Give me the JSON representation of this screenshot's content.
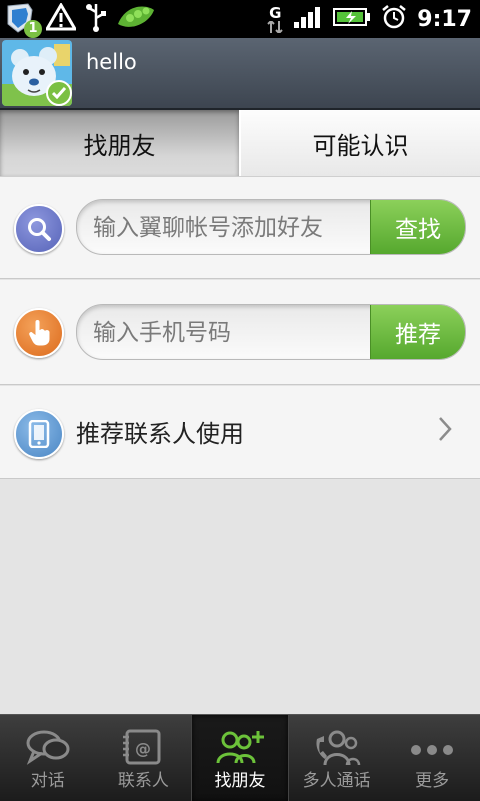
{
  "status_bar": {
    "time": "9:17",
    "notification_badge": "1",
    "network_type": "G",
    "icons": [
      "shield-icon",
      "warning-icon",
      "usb-icon",
      "peapod-icon",
      "signal-icon",
      "battery-icon",
      "alarm-icon"
    ]
  },
  "profile": {
    "username": "hello",
    "online_status": "check"
  },
  "tabs": [
    {
      "label": "找朋友",
      "active": true
    },
    {
      "label": "可能认识",
      "active": false
    }
  ],
  "search_account": {
    "placeholder": "输入翼聊帐号添加好友",
    "value": "",
    "button_label": "查找",
    "icon": "search-icon"
  },
  "search_phone": {
    "placeholder": "输入手机号码",
    "value": "",
    "button_label": "推荐",
    "icon": "pointing-hand-icon"
  },
  "recommend_contacts": {
    "label": "推荐联系人使用",
    "icon": "phone-device-icon"
  },
  "bottom_nav": [
    {
      "label": "对话",
      "icon": "chat-bubbles-icon",
      "active": false
    },
    {
      "label": "联系人",
      "icon": "address-book-icon",
      "active": false
    },
    {
      "label": "找朋友",
      "icon": "add-friend-icon",
      "active": true
    },
    {
      "label": "多人通话",
      "icon": "group-call-icon",
      "active": false
    },
    {
      "label": "更多",
      "icon": "more-dots-icon",
      "active": false
    }
  ],
  "colors": {
    "accent_green": "#63b236",
    "header_bg": "#4b5460",
    "search_icon_bg": "#6773c4",
    "hand_icon_bg": "#e8812f",
    "phone_icon_bg": "#6a9fd3"
  }
}
